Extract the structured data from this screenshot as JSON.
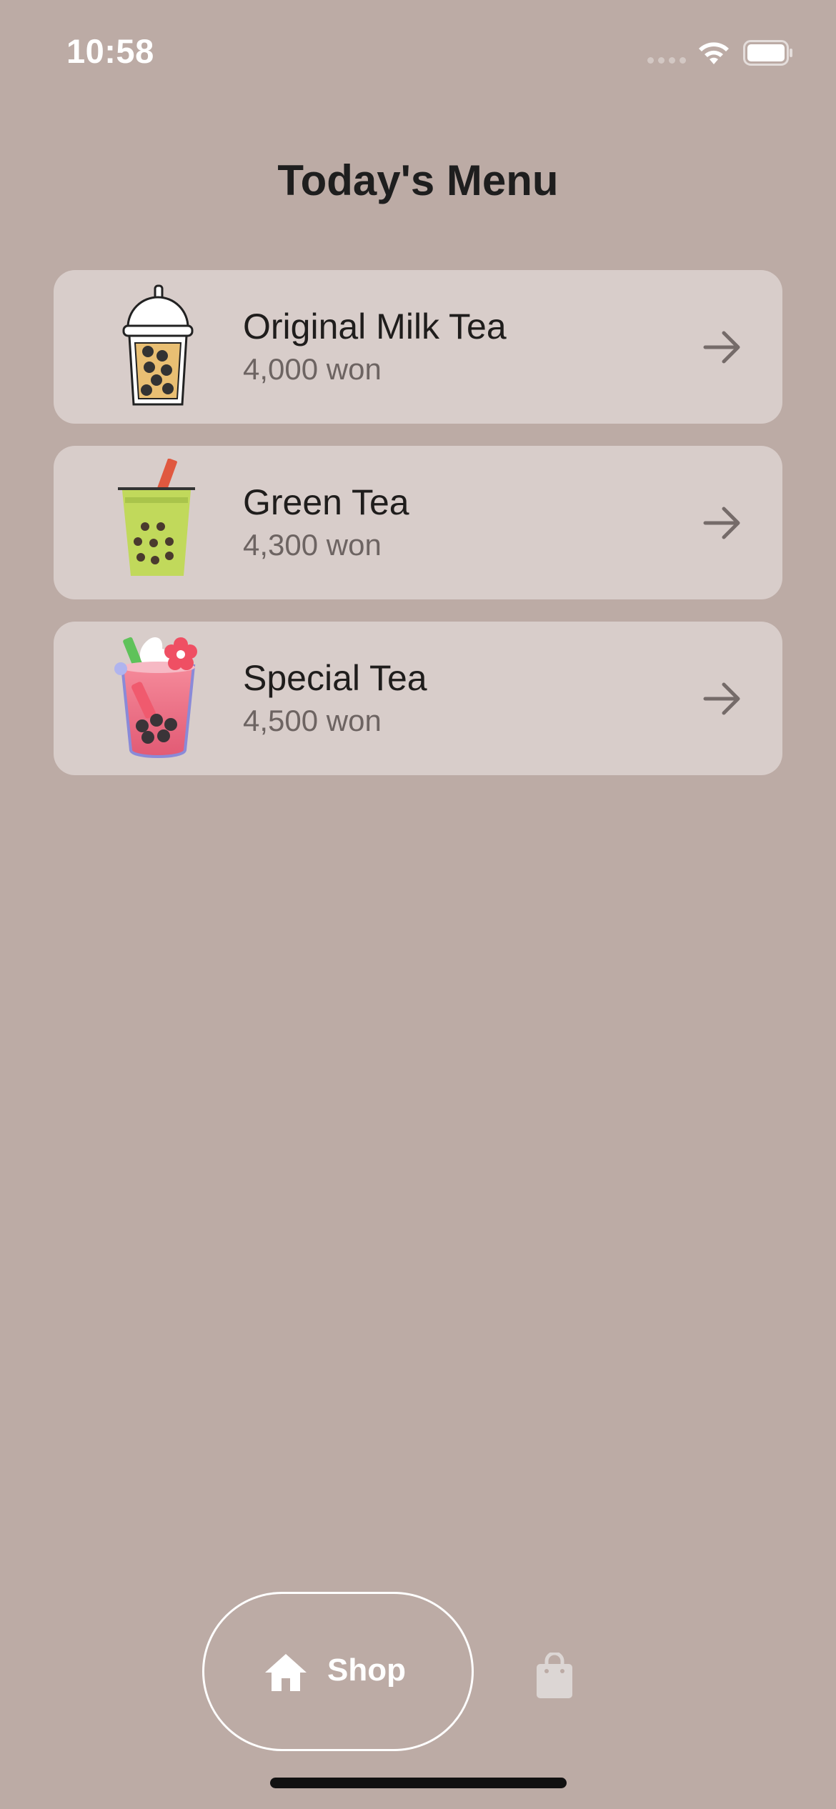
{
  "status_bar": {
    "time": "10:58",
    "signal_icon": "signal-dots-icon",
    "wifi_icon": "wifi-icon",
    "battery_icon": "battery-icon"
  },
  "header": {
    "title": "Today's Menu"
  },
  "menu": {
    "items": [
      {
        "name": "Original Milk Tea",
        "price": "4,000 won",
        "image_icon": "milk-tea-cup-icon",
        "action_icon": "arrow-right-icon"
      },
      {
        "name": "Green Tea",
        "price": "4,300 won",
        "image_icon": "green-tea-cup-icon",
        "action_icon": "arrow-right-icon"
      },
      {
        "name": "Special Tea",
        "price": "4,500 won",
        "image_icon": "special-tea-cup-icon",
        "action_icon": "arrow-right-icon"
      }
    ]
  },
  "bottom_nav": {
    "shop_label": "Shop",
    "shop_icon": "home-icon",
    "cart_icon": "shopping-bag-icon"
  },
  "colors": {
    "background": "#bcaba5",
    "card": "#d8cdca",
    "title_text": "#1e1e1e",
    "price_text": "#6d6462",
    "arrow": "#756b69",
    "nav_foreground": "#ffffff"
  }
}
